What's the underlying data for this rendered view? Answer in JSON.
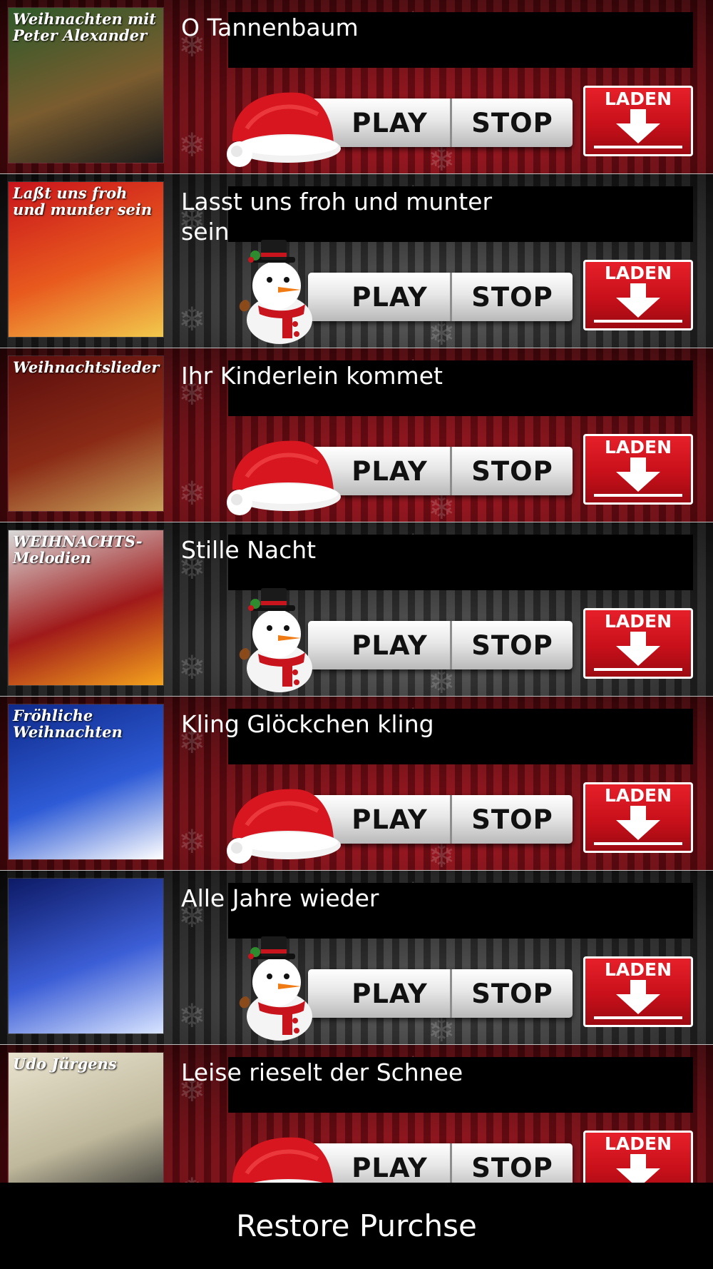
{
  "songs": [
    {
      "title": "O Tannenbaum",
      "icon": "santa-hat-icon",
      "theme": "red",
      "album": {
        "text": "Weihnachten mit Peter Alexander",
        "colors": [
          "#2e5a2a",
          "#7a5c2f",
          "#1c1c1c"
        ]
      }
    },
    {
      "title": "Lasst uns froh und munter sein",
      "icon": "snowman-icon",
      "theme": "dark",
      "album": {
        "text": "Laßt uns froh und munter sein",
        "colors": [
          "#c8141c",
          "#e85a1e",
          "#f2c94c"
        ]
      }
    },
    {
      "title": "Ihr Kinderlein kommet",
      "icon": "santa-hat-icon",
      "theme": "red",
      "album": {
        "text": "Weihnachtslieder",
        "colors": [
          "#5a0d0d",
          "#8a2a16",
          "#caa35a"
        ]
      }
    },
    {
      "title": "Stille Nacht",
      "icon": "snowman-icon",
      "theme": "dark",
      "album": {
        "text": "WEIHNACHTS-Melodien",
        "colors": [
          "#d9d9d9",
          "#a01a1a",
          "#f4a21c"
        ]
      }
    },
    {
      "title": "Kling Glöckchen kling",
      "icon": "santa-hat-icon",
      "theme": "red",
      "album": {
        "text": "Fröhliche Weihnachten",
        "colors": [
          "#0f2a8a",
          "#2e5bd6",
          "#ffffff"
        ]
      }
    },
    {
      "title": "Alle Jahre wieder",
      "icon": "snowman-icon",
      "theme": "dark",
      "album": {
        "text": "",
        "colors": [
          "#0d1a66",
          "#3c5ed6",
          "#d8e4ff"
        ]
      }
    },
    {
      "title": "Leise rieselt der Schnee",
      "icon": "santa-hat-icon",
      "theme": "red",
      "album": {
        "text": "Udo Jürgens",
        "colors": [
          "#e9e3cf",
          "#bfb89c",
          "#2a2a2a"
        ]
      }
    }
  ],
  "buttons": {
    "play": "PLAY",
    "stop": "STOP",
    "download": "LADEN"
  },
  "footer": {
    "restore_label": "Restore Purchse"
  },
  "colors": {
    "download_red": "#d0121c",
    "hat_red": "#d7161f"
  }
}
